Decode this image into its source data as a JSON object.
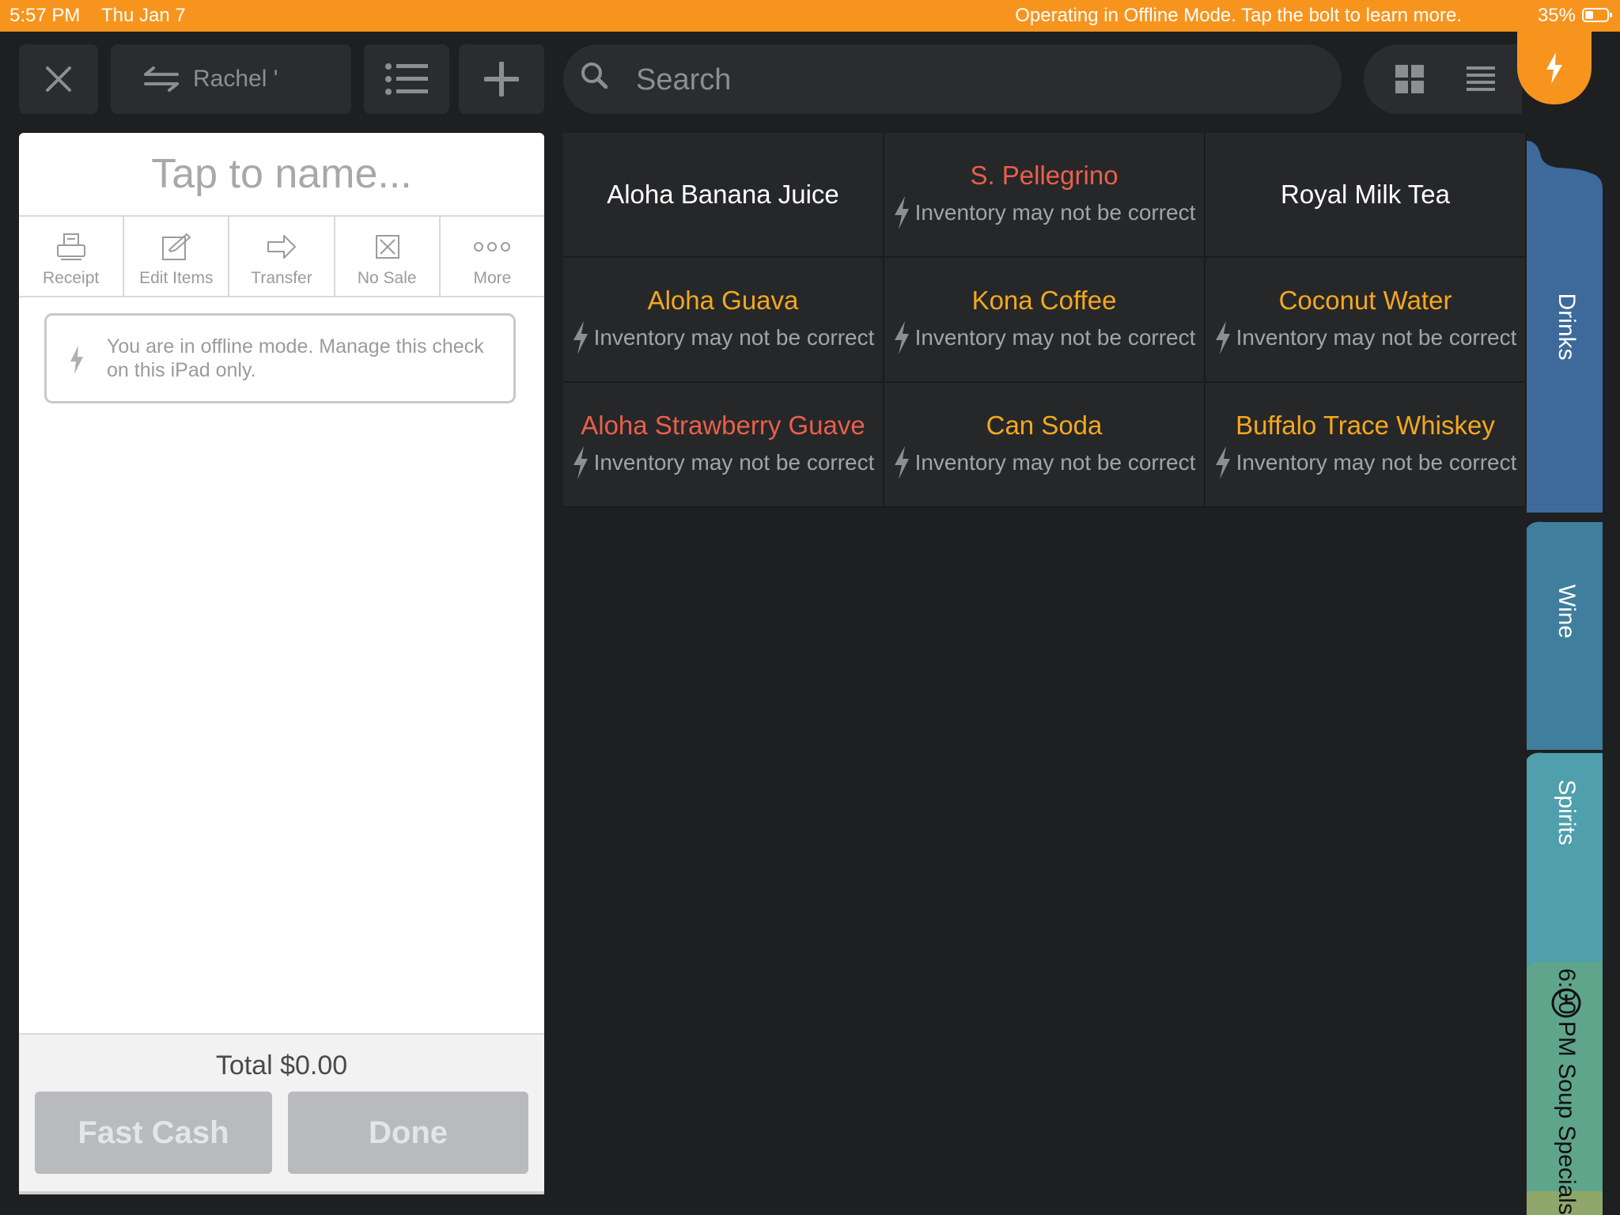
{
  "status_bar": {
    "time": "5:57 PM",
    "date": "Thu Jan 7",
    "message": "Operating in Offline Mode. Tap the bolt to learn more.",
    "battery": "35%"
  },
  "toolbar": {
    "server_name": "Rachel '",
    "search_placeholder": "Search"
  },
  "check": {
    "name_placeholder": "Tap to name...",
    "actions": [
      {
        "label": "Receipt",
        "icon": "receipt-icon"
      },
      {
        "label": "Edit Items",
        "icon": "edit-icon"
      },
      {
        "label": "Transfer",
        "icon": "transfer-icon"
      },
      {
        "label": "No Sale",
        "icon": "no-sale-icon"
      },
      {
        "label": "More",
        "icon": "more-icon"
      }
    ],
    "offline_message": "You are in offline mode. Manage this check on this iPad only.",
    "total": "Total $0.00",
    "fast_cash_label": "Fast Cash",
    "done_label": "Done"
  },
  "items": [
    {
      "name": "Aloha Banana Juice",
      "color": "#ffffff",
      "inventory_note": ""
    },
    {
      "name": "S. Pellegrino",
      "color": "#e8604a",
      "inventory_note": "Inventory may not be correct"
    },
    {
      "name": "Royal Milk Tea",
      "color": "#ffffff",
      "inventory_note": ""
    },
    {
      "name": "Aloha Guava",
      "color": "#f4a81d",
      "inventory_note": "Inventory may not be correct"
    },
    {
      "name": "Kona Coffee",
      "color": "#f4a81d",
      "inventory_note": "Inventory may not be correct"
    },
    {
      "name": "Coconut Water",
      "color": "#f4a81d",
      "inventory_note": "Inventory may not be correct"
    },
    {
      "name": "Aloha Strawberry Guave",
      "color": "#e8604a",
      "inventory_note": "Inventory may not be correct"
    },
    {
      "name": "Can Soda",
      "color": "#f4a81d",
      "inventory_note": "Inventory may not be correct"
    },
    {
      "name": "Buffalo Trace Whiskey",
      "color": "#f4a81d",
      "inventory_note": "Inventory may not be correct"
    }
  ],
  "categories": [
    {
      "label": "Drinks",
      "color": "#3d6a9a"
    },
    {
      "label": "Wine",
      "color": "#3f7e9c"
    },
    {
      "label": "Spirits",
      "color": "#4f9fad"
    },
    {
      "label": "6:00 PM Soup Specials",
      "color": "#5fa58c"
    }
  ],
  "colors": {
    "accent": "#f7941e",
    "background": "#1e1f21",
    "tile": "#262729"
  }
}
